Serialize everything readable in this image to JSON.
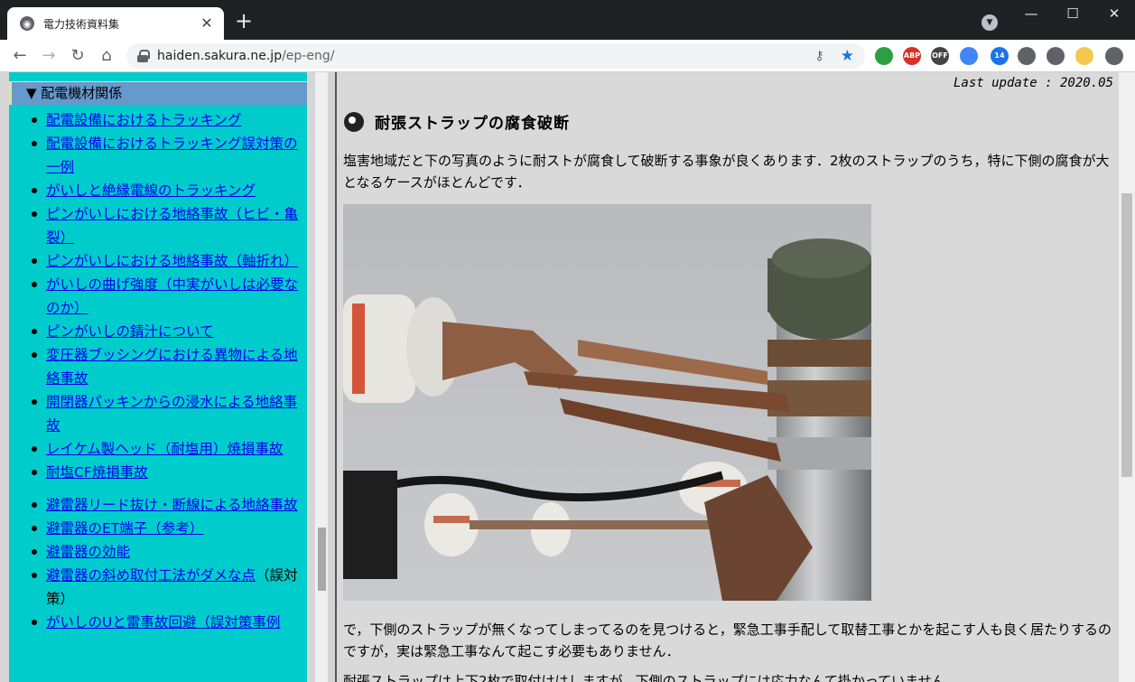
{
  "browser": {
    "tab": {
      "title": "電力技術資料集",
      "close_glyph": "✕"
    },
    "new_tab_glyph": "+",
    "window": {
      "minimize": "—",
      "maximize": "☐",
      "close": "✕"
    },
    "url": {
      "host": "haiden.sakura.ne.jp",
      "path": "/ep-eng/"
    },
    "extensions": [
      {
        "name": "ext-green-icon",
        "color": "#2e9e44",
        "label": ""
      },
      {
        "name": "adblock-icon",
        "color": "#d93025",
        "label": "ABP"
      },
      {
        "name": "off-badge-icon",
        "color": "#444444",
        "label": "OFF"
      },
      {
        "name": "translate-icon",
        "color": "#4285f4",
        "label": ""
      },
      {
        "name": "feed-icon",
        "color": "#1a73e8",
        "label": "14"
      },
      {
        "name": "puzzle-icon",
        "color": "#5f6368",
        "label": ""
      },
      {
        "name": "reading-list-icon",
        "color": "#5f6368",
        "label": ""
      },
      {
        "name": "profile-avatar-icon",
        "color": "#f2c94c",
        "label": ""
      },
      {
        "name": "menu-icon",
        "color": "#5f6368",
        "label": ""
      }
    ]
  },
  "sidebar": {
    "section_title": "▼ 配電機材関係",
    "items": [
      {
        "label": "配電設備におけるトラッキング",
        "link": true
      },
      {
        "label": "配電設備におけるトラッキング誤対策の一例",
        "link": true
      },
      {
        "label": "がいしと絶縁電線のトラッキング",
        "link": true
      },
      {
        "label": "ピンがいしにおける地絡事故（ヒビ・亀裂）",
        "link": true
      },
      {
        "label": "ピンがいしにおける地絡事故（軸折れ）",
        "link": true
      },
      {
        "label": "がいしの曲げ強度（中実がいしは必要なのか）",
        "link": true
      },
      {
        "label": "ピンがいしの錆汁について",
        "link": true
      },
      {
        "label": "変圧器ブッシングにおける異物による地絡事故",
        "link": true
      },
      {
        "label": "開閉器パッキンからの浸水による地絡事故",
        "link": true
      },
      {
        "label": "レイケム製ヘッド（耐塩用）焼損事故",
        "link": true
      },
      {
        "label": "耐塩CF焼損事故",
        "link": true
      }
    ],
    "items2": [
      {
        "label": "避雷器リード抜け・断線による地絡事故",
        "link": true
      },
      {
        "label": "避雷器のET端子（参考）",
        "link": true
      },
      {
        "label": "避雷器の効能",
        "link": true
      },
      {
        "label": "避雷器の斜め取付工法がダメな点",
        "link": true,
        "suffix": "（誤対策）"
      },
      {
        "label": "がいしのUと雷事故回避（誤対策事例",
        "link": true
      }
    ]
  },
  "main": {
    "last_update": "Last update : 2020.05",
    "title": "耐張ストラップの腐食破断",
    "para1": "塩害地域だと下の写真のように耐ストが腐食して破断する事象が良くあります．2枚のストラップのうち，特に下側の腐食が大となるケースがほとんどです．",
    "para2": "で，下側のストラップが無くなってしまってるのを見つけると，緊急工事手配して取替工事とかを起こす人も良く居たりするのですが，実は緊急工事なんて起こす必要もありません．",
    "para3": "耐張ストラップは上下2枚で取付けはしますが，下側のストラップには応力なんて掛かっていません．"
  }
}
